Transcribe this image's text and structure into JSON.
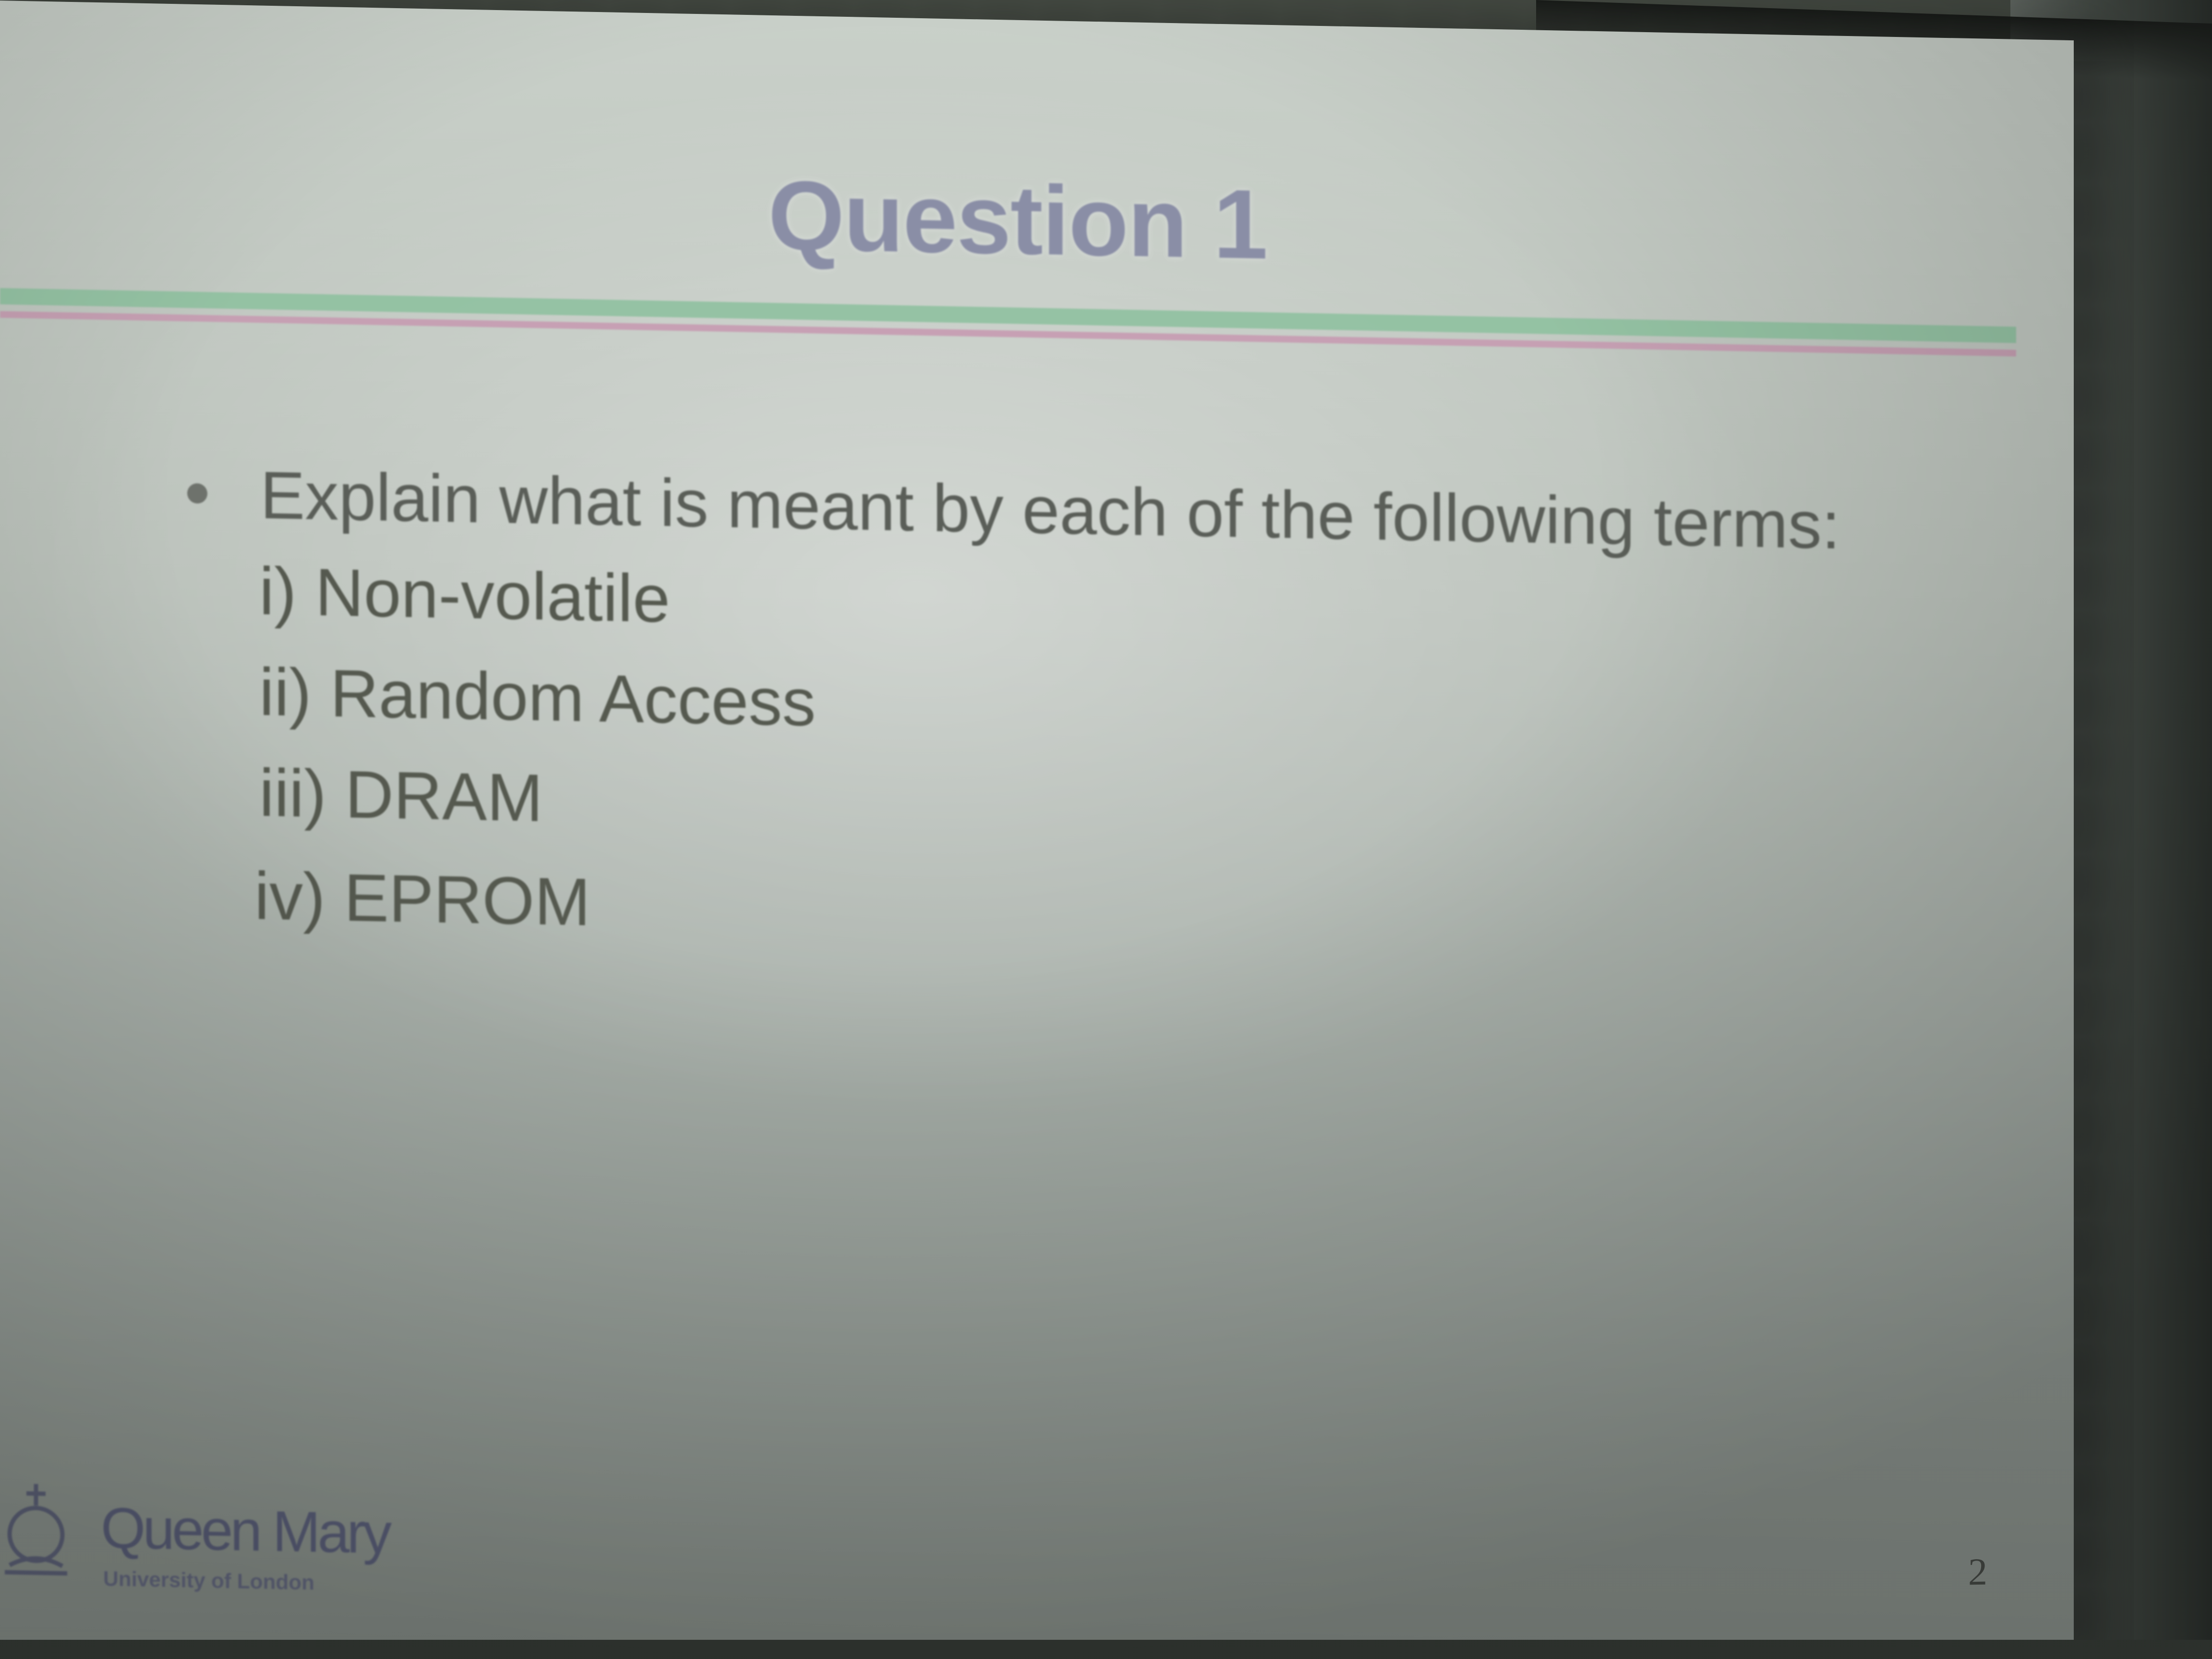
{
  "slide": {
    "title": "Question 1",
    "bullet": "Explain what is meant by each of the following terms:",
    "terms": [
      "i) Non-volatile",
      "ii) Random Access",
      "iii) DRAM",
      "iv) EPROM"
    ],
    "logo": {
      "name": "Queen Mary",
      "subtitle": "University of London",
      "icon": "crown-icon"
    },
    "page_number": "2"
  },
  "colors": {
    "title": "#8a8ea6",
    "rule_green": "#8fc1a0",
    "rule_pink": "#c79bb1",
    "body_text": "#55594f",
    "logo": "#5f6480"
  }
}
